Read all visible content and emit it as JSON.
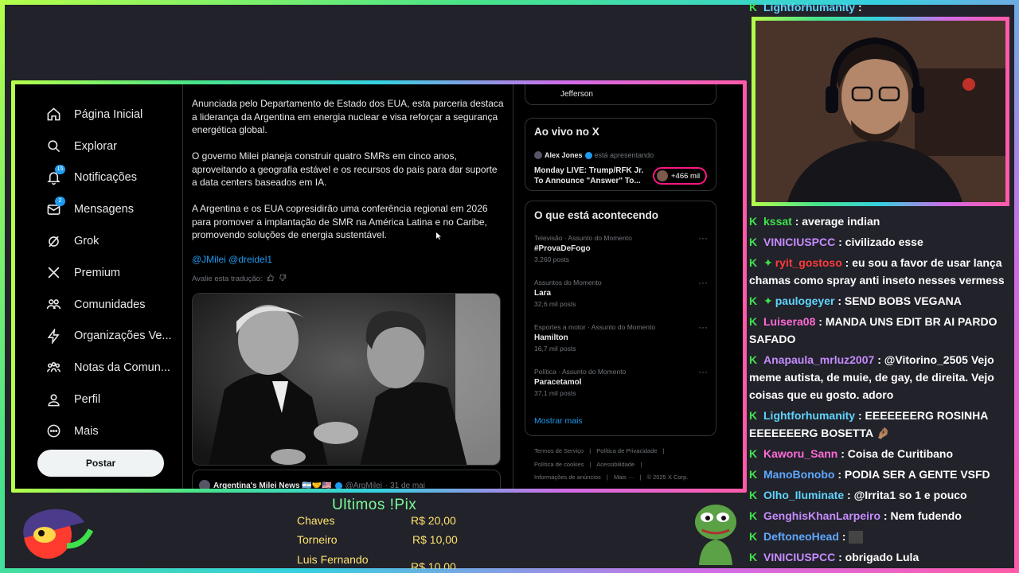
{
  "nav": {
    "items": [
      {
        "label": "Página Inicial",
        "icon": "home-icon"
      },
      {
        "label": "Explorar",
        "icon": "search-icon"
      },
      {
        "label": "Notificações",
        "icon": "bell-icon",
        "badge": "15"
      },
      {
        "label": "Mensagens",
        "icon": "mail-icon",
        "badge": "2"
      },
      {
        "label": "Grok",
        "icon": "grok-icon"
      },
      {
        "label": "Premium",
        "icon": "x-logo-icon"
      },
      {
        "label": "Comunidades",
        "icon": "communities-icon"
      },
      {
        "label": "Organizações Ve...",
        "icon": "lightning-icon"
      },
      {
        "label": "Notas da Comun...",
        "icon": "notes-icon"
      },
      {
        "label": "Perfil",
        "icon": "person-icon"
      },
      {
        "label": "Mais",
        "icon": "more-icon"
      }
    ],
    "post_button": "Postar"
  },
  "tweet": {
    "paragraphs": [
      "Anunciada pelo Departamento de Estado dos EUA, esta parceria destaca a liderança da Argentina em energia nuclear e visa reforçar a segurança energética global.",
      "O governo Milei planeja construir quatro SMRs em cinco anos, aproveitando a geografia estável e os recursos do país para dar suporte a data centers baseados em IA.",
      "A Argentina e os EUA copresidirão uma conferência regional em 2026 para promover a implantação de SMR na América Latina e no Caribe, promovendo soluções de energia sustentável."
    ],
    "mentions": "@JMilei @dreidel1",
    "translate_label": "Avalie esta tradução:",
    "quote": {
      "name": "Argentina's Milei News 🇦🇷🤝🇺🇸",
      "handle": "@ArgMilei",
      "date": "· 31 de mai"
    }
  },
  "right": {
    "top_name": "Jefferson",
    "live": {
      "title": "Ao vivo no X",
      "host": "Alex Jones",
      "host_suffix": "está apresentando",
      "text": "Monday LIVE: Trump/RFK Jr. To Announce \"Answer\" To...",
      "listeners": "+466 mil"
    },
    "trends": {
      "title": "O que está acontecendo",
      "items": [
        {
          "meta": "Televisão · Assunto do Momento",
          "name": "#ProvaDeFogo",
          "count": "3.260 posts"
        },
        {
          "meta": "Assuntos do Momento",
          "name": "Lara",
          "count": "32,6 mil posts"
        },
        {
          "meta": "Esportes a motor · Assunto do Momento",
          "name": "Hamilton",
          "count": "16,7 mil posts"
        },
        {
          "meta": "Política · Assunto do Momento",
          "name": "Paracetamol",
          "count": "37,1 mil posts"
        }
      ],
      "show_more": "Mostrar mais"
    },
    "footer": {
      "line1": [
        "Termos de Serviço",
        "|",
        "Política de Privacidade",
        "|"
      ],
      "line2": [
        "Política de cookies",
        "|",
        "Acessibilidade",
        "|"
      ],
      "line3": [
        "Informações de anúncios",
        "|",
        "Mais ···",
        "|",
        "© 2025 X Corp."
      ]
    }
  },
  "chat": {
    "top_partial": {
      "user": "Lightforhumanity",
      "text": ":"
    },
    "messages": [
      {
        "user": "kssat",
        "color": "#3fe14c",
        "text": ": average indian"
      },
      {
        "user": "VINICIUSPCC",
        "color": "#c58cff",
        "text": ": civilizado esse"
      },
      {
        "user": "ryit_gostoso",
        "color": "#ff3b3b",
        "text": ": eu sou a favor de usar lança chamas como spray anti inseto nesses vermess",
        "diamond": true
      },
      {
        "user": "paulogeyer",
        "color": "#5fd4ff",
        "text": ": SEND BOBS VEGANA",
        "diamond": true
      },
      {
        "user": "Luisera08",
        "color": "#ff6bd6",
        "text": ": MANDA UNS EDIT BR AI PARDO SAFADO"
      },
      {
        "user": "Anapaula_mrluz2007",
        "color": "#c58cff",
        "text": ": @Vitorino_2505 Vejo meme autista, de muie, de gay, de direita. Vejo coisas que eu gosto. adoro"
      },
      {
        "user": "Lightforhumanity",
        "color": "#5fd4ff",
        "text": ": EEEEEEERG ROSINHA EEEEEEERG BOSETTA 🤌🏽"
      },
      {
        "user": "Kaworu_Sann",
        "color": "#ff6bd6",
        "text": ": Coisa de Curitibano"
      },
      {
        "user": "ManoBonobo",
        "color": "#5fa8ff",
        "text": ": PODIA SER A GENTE VSFD"
      },
      {
        "user": "Olho_Iluminate",
        "color": "#5fd4ff",
        "text": ": @Irrita1 so 1 e pouco"
      },
      {
        "user": "GenghisKhanLarpeiro",
        "color": "#c58cff",
        "text": ": Nem fudendo"
      },
      {
        "user": "DeftoneoHead",
        "color": "#5fa8ff",
        "text": ":"
      },
      {
        "user": "VINICIUSPCC",
        "color": "#c58cff",
        "text": ": obrigado Lula"
      }
    ]
  },
  "pix": {
    "title": "Ultimos !Pix",
    "rows": [
      {
        "name": "Chaves",
        "amount": "R$ 20,00"
      },
      {
        "name": "Torneiro",
        "amount": "R$ 10,00"
      },
      {
        "name": "Luis Fernando",
        "amount": "R$ 10,00"
      }
    ]
  }
}
